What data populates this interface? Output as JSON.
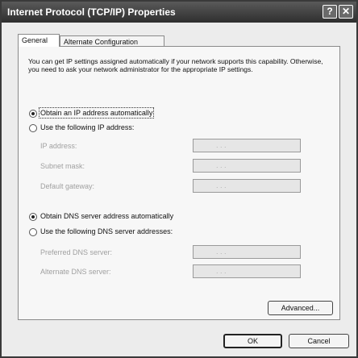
{
  "window": {
    "title": "Internet Protocol (TCP/IP) Properties",
    "help_label": "?",
    "close_label": "✕"
  },
  "tabs": [
    {
      "label": "General",
      "active": true
    },
    {
      "label": "Alternate Configuration",
      "active": false
    }
  ],
  "general": {
    "description": "You can get IP settings assigned automatically if your network supports this capability. Otherwise, you need to ask your network administrator for the appropriate IP settings.",
    "ip_auto": {
      "label": "Obtain an IP address automatically",
      "checked": true
    },
    "ip_manual": {
      "label": "Use the following IP address:",
      "checked": false
    },
    "ip_fields": [
      {
        "label": "IP address:",
        "value": ". . ."
      },
      {
        "label": "Subnet mask:",
        "value": ". . ."
      },
      {
        "label": "Default gateway:",
        "value": ". . ."
      }
    ],
    "dns_auto": {
      "label": "Obtain DNS server address automatically",
      "checked": true
    },
    "dns_manual": {
      "label": "Use the following DNS server addresses:",
      "checked": false
    },
    "dns_fields": [
      {
        "label": "Preferred DNS server:",
        "value": ". . ."
      },
      {
        "label": "Alternate DNS server:",
        "value": ". . ."
      }
    ],
    "advanced_label": "Advanced..."
  },
  "footer": {
    "ok_label": "OK",
    "cancel_label": "Cancel"
  }
}
